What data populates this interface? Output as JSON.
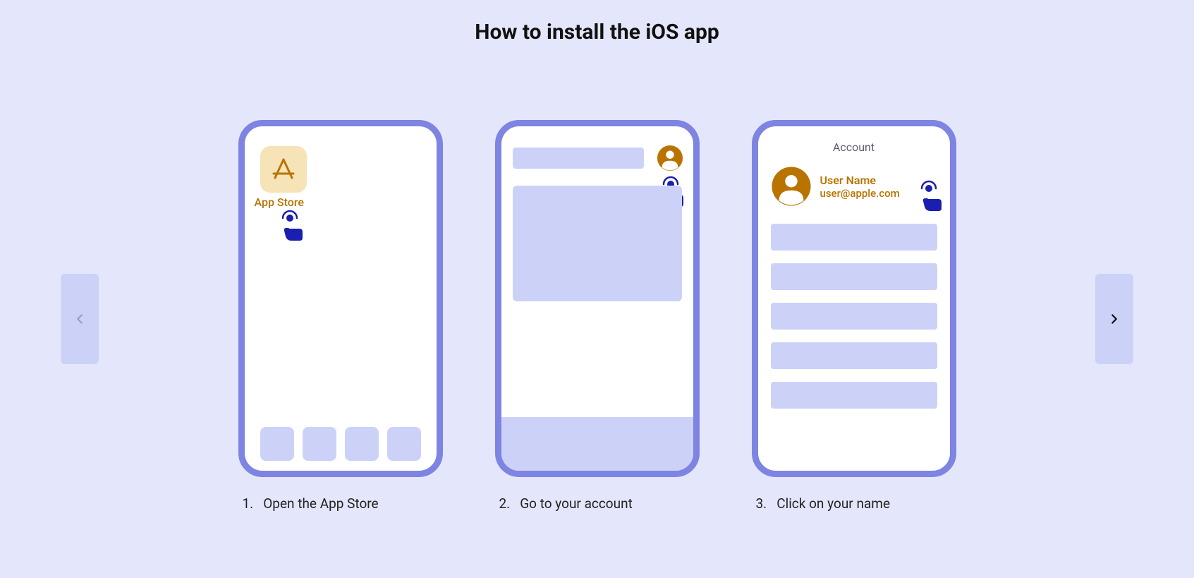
{
  "title": "How to install the iOS app",
  "steps": [
    {
      "num": "1.",
      "label": "Open the App Store",
      "app_label": "App Store"
    },
    {
      "num": "2.",
      "label": "Go to your account"
    },
    {
      "num": "3.",
      "label": "Click on your name",
      "account_header": "Account",
      "user_name": "User Name",
      "user_email": "user@apple.com"
    }
  ]
}
